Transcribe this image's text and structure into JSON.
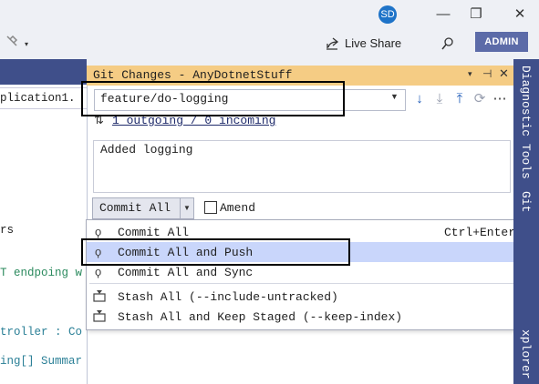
{
  "titlebar": {
    "avatar_initials": "SD",
    "minimize": "—",
    "restore": "❐",
    "close": "✕"
  },
  "toolbar": {
    "live_share": "Live Share",
    "admin": "ADMIN"
  },
  "editor": {
    "lines": [
      "plication1.",
      "rs",
      "T endpoing w",
      "troller : Co",
      "ing[] Summar"
    ]
  },
  "git_changes": {
    "title": "Git Changes - AnyDotnetStuff",
    "branch": "feature/do-logging",
    "outgoing_incoming": "1 outgoing / 0 incoming",
    "commit_message": "Added logging",
    "commit_button": "Commit All",
    "amend_label": "Amend",
    "menu": [
      {
        "label": "Commit All",
        "shortcut": "Ctrl+Enter",
        "icon": "commit-icon"
      },
      {
        "label": "Commit All and Push",
        "shortcut": "",
        "icon": "commit-icon"
      },
      {
        "label": "Commit All and Sync",
        "shortcut": "",
        "icon": "commit-icon"
      },
      {
        "label": "Stash All (--include-untracked)",
        "shortcut": "",
        "icon": "stash-icon"
      },
      {
        "label": "Stash All and Keep Staged (--keep-index)",
        "shortcut": "",
        "icon": "stash-icon"
      }
    ]
  },
  "side_tabs": {
    "diagnostic_tools": "Diagnostic Tools",
    "git": "Git",
    "explorer": "xplorer"
  },
  "colors": {
    "accent": "#3f4f8a",
    "git_title_bg": "#f5cc84",
    "selection": "#c9d6fb",
    "admin_bg": "#5c6ba8"
  }
}
